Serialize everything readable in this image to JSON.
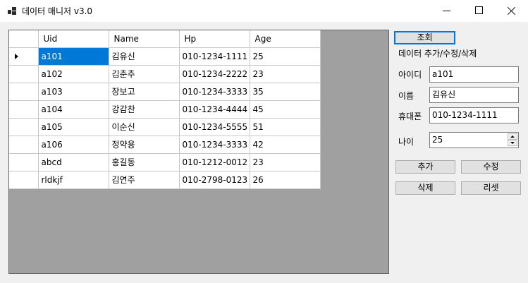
{
  "window": {
    "title": "데이터 매니저 v3.0"
  },
  "grid": {
    "columns": [
      "Uid",
      "Name",
      "Hp",
      "Age"
    ],
    "rows": [
      [
        "a101",
        "김유신",
        "010-1234-1111",
        "25"
      ],
      [
        "a102",
        "김춘추",
        "010-1234-2222",
        "23"
      ],
      [
        "a103",
        "장보고",
        "010-1234-3333",
        "35"
      ],
      [
        "a104",
        "강감찬",
        "010-1234-4444",
        "45"
      ],
      [
        "a105",
        "이순신",
        "010-1234-5555",
        "51"
      ],
      [
        "a106",
        "정약용",
        "010-1234-3333",
        "42"
      ],
      [
        "abcd",
        "홍길동",
        "010-1212-0012",
        "23"
      ],
      [
        "rldkjf",
        "김연주",
        "010-2798-0123",
        "26"
      ]
    ],
    "selected_row": 0
  },
  "panel": {
    "search_label": "조회",
    "section_title": "데이터 추가/수정/삭제",
    "fields": {
      "id_label": "아이디",
      "id_value": "a101",
      "name_label": "이름",
      "name_value": "김유신",
      "phone_label": "휴대폰",
      "phone_value": "010-1234-1111",
      "age_label": "나이",
      "age_value": "25"
    },
    "add_label": "추가",
    "update_label": "수정",
    "delete_label": "삭제",
    "reset_label": "리셋"
  },
  "colors": {
    "selection": "#0078d7",
    "grid_background": "#a0a0a0",
    "window_background": "#f0f0f0"
  },
  "icons": [
    "app-icon",
    "minimize-icon",
    "maximize-icon",
    "close-icon",
    "row-pointer-icon",
    "spin-up-icon",
    "spin-down-icon"
  ]
}
